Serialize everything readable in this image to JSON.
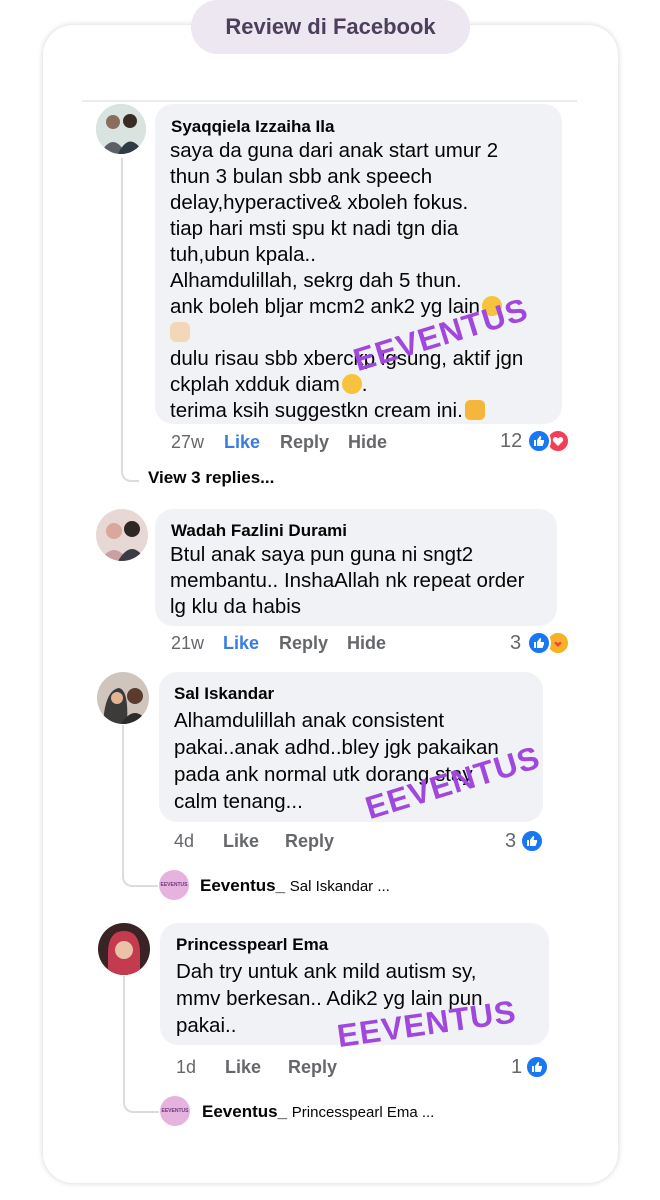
{
  "header": {
    "title": "Review di Facebook"
  },
  "comments": [
    {
      "name": "Syaqqiela Izzaiha Ila",
      "lines": [
        "saya da guna dari anak start umur 2",
        "thun 3 bulan sbb ank speech",
        "delay,hyperactive& xboleh fokus.",
        "tiap hari msti spu kt nadi tgn dia",
        "tuh,ubun kpala..",
        "Alhamdulillah, sekrg dah 5 thun.",
        "ank boleh bljar mcm2 ank2 yg lain",
        "",
        "dulu risau sbb xberckp lgsung, aktif jgn",
        "ckplah xdduk diam",
        "terima ksih suggestkn cream ini."
      ],
      "time": "27w",
      "like": "Like",
      "reply": "Reply",
      "hide": "Hide",
      "count": "12",
      "view_replies": "View 3 replies..."
    },
    {
      "name": "Wadah Fazlini Durami",
      "lines": [
        "Btul anak saya pun guna ni sngt2",
        "membantu.. InshaAllah nk repeat order",
        "lg klu da habis"
      ],
      "time": "21w",
      "like": "Like",
      "reply": "Reply",
      "hide": "Hide",
      "count": "3"
    },
    {
      "name": "Sal Iskandar",
      "lines": [
        "Alhamdulillah anak consistent",
        "pakai..anak adhd..bley jgk pakaikan",
        "pada ank normal utk dorang stay",
        "calm tenang..."
      ],
      "time": "4d",
      "like": "Like",
      "reply": "Reply",
      "count": "3",
      "reply_preview": {
        "author": "Eeventus_",
        "text": "Sal Iskandar ..."
      }
    },
    {
      "name": "Princesspearl Ema",
      "lines": [
        "Dah try untuk ank mild autism sy,",
        "mmv berkesan.. Adik2 yg lain pun",
        "pakai.."
      ],
      "time": "1d",
      "like": "Like",
      "reply": "Reply",
      "count": "1",
      "reply_preview": {
        "author": "Eeventus_",
        "text": "Princesspearl Ema ..."
      }
    }
  ],
  "watermark": "EEVENTUS",
  "mini_logo": "EEVENTUS",
  "colors": {
    "like_blue": "#1877f2",
    "love_red": "#f33e58",
    "watermark": "#a048dd",
    "bubble": "#f0f2f5"
  }
}
